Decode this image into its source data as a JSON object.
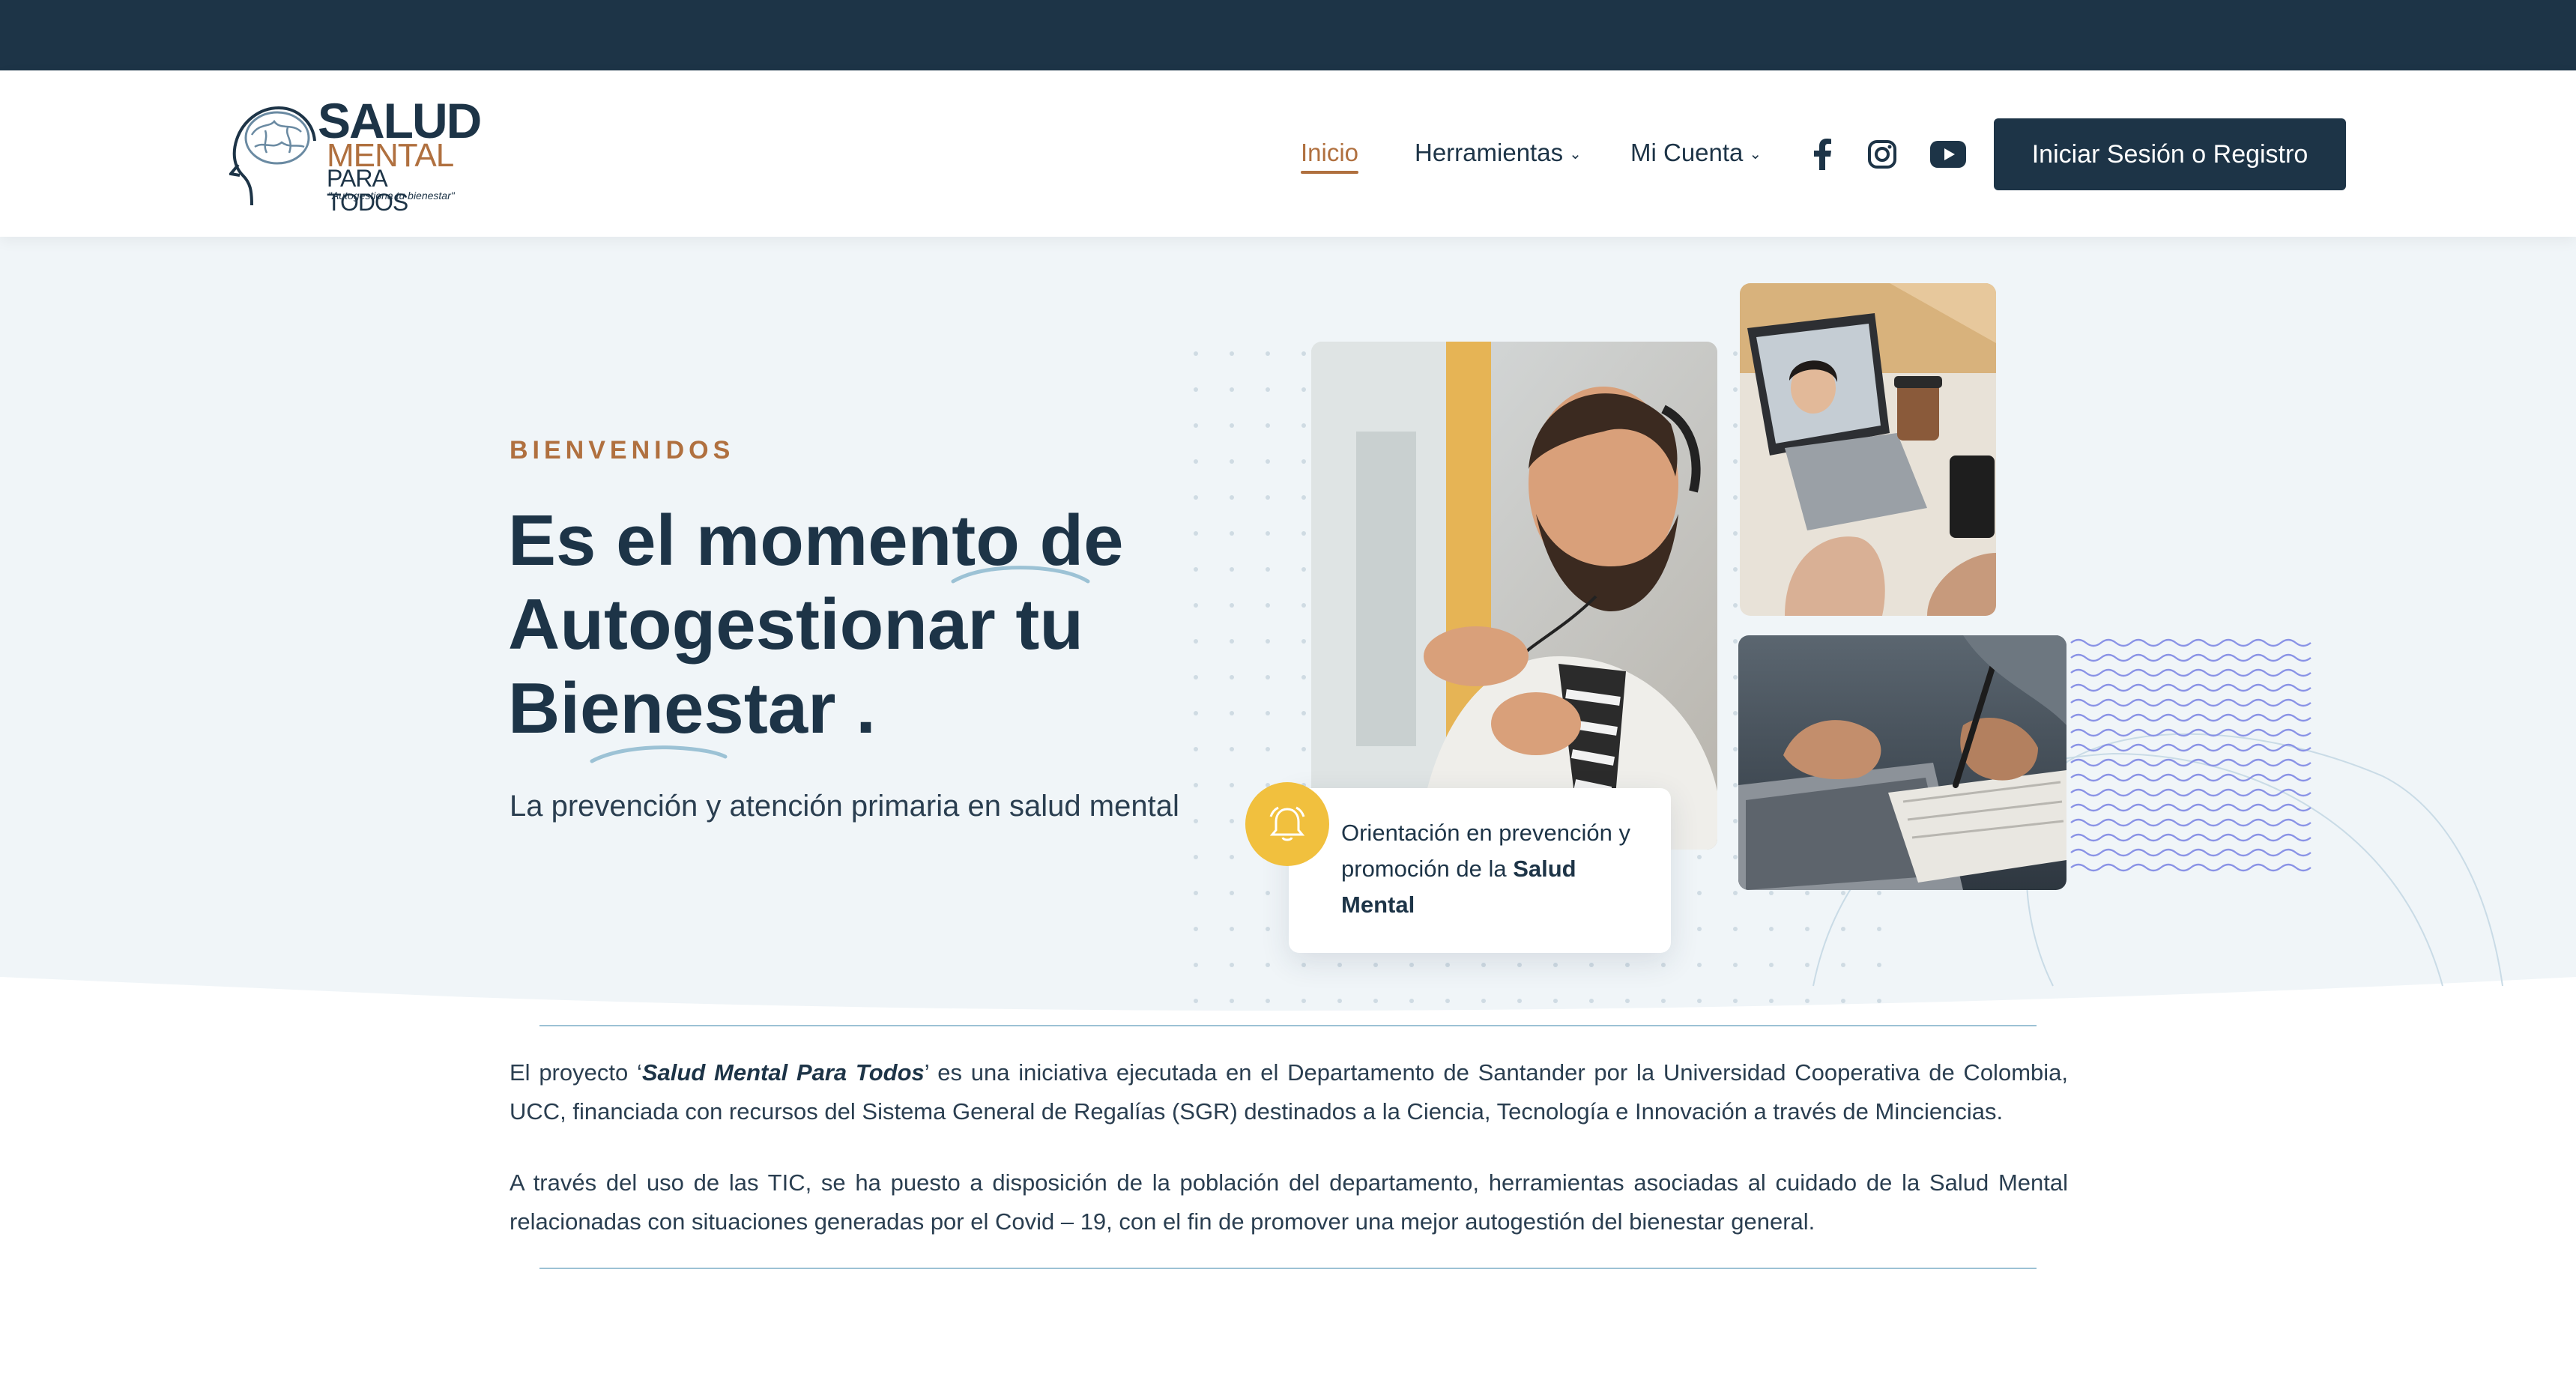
{
  "header": {
    "logo": {
      "line1": "SALUD",
      "line2": "MENTAL",
      "line3": "PARA TODOS",
      "tagline": "\"Autogestiona tu bienestar\""
    },
    "nav": {
      "home": "Inicio",
      "tools": "Herramientas",
      "account": "Mi Cuenta"
    },
    "social": [
      "facebook-icon",
      "instagram-icon",
      "youtube-icon"
    ],
    "login_label": "Iniciar Sesión o Registro"
  },
  "hero": {
    "eyebrow": "BIENVENIDOS",
    "headline": [
      "Es el momento de",
      "Autogestionar tu",
      "Bienestar ."
    ],
    "subline": "La prevención y atención primaria en salud mental",
    "card": {
      "text_before": "Orientación en prevención y promoción de la ",
      "text_bold": "Salud Mental"
    }
  },
  "about": {
    "p1_before": "El proyecto ‘",
    "p1_bold": "Salud Mental Para Todos",
    "p1_after": "’ es una iniciativa ejecutada en el Departamento de Santander por la Universidad Cooperativa de Colombia, UCC, financiada con recursos del Sistema General de Regalías (SGR) destinados a la Ciencia, Tecnología e Innovación a través de Minciencias.",
    "p2": "A través del uso de las TIC, se ha puesto a disposición de la población del departamento, herramientas asociadas al cuidado de la Salud Mental relacionadas con situaciones generadas por el Covid – 19, con el fin de promover una mejor autogestión del bienestar general."
  },
  "colors": {
    "navy": "#1d3447",
    "accent": "#b0703f",
    "bell": "#f1c03e",
    "hero_bg": "#f0f5f8"
  }
}
